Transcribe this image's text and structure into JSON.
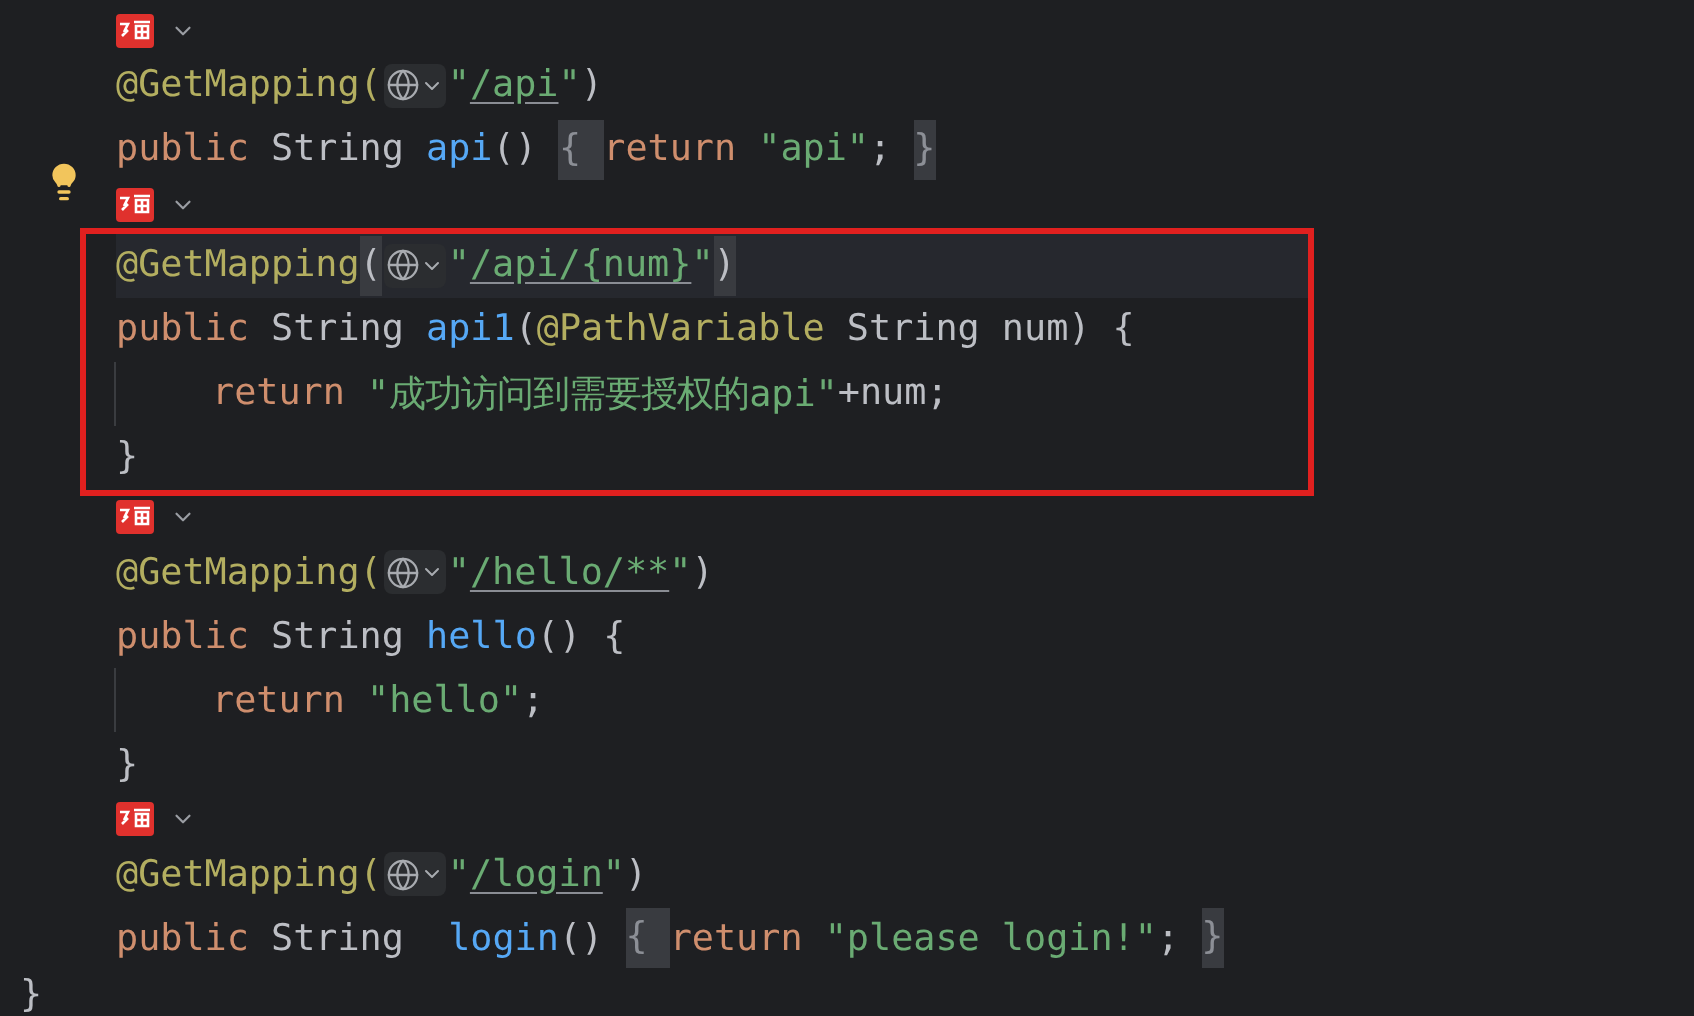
{
  "editor": {
    "methods": [
      {
        "outlined": false,
        "lightbulb": false,
        "lines": [
          {
            "current": false,
            "indented": false,
            "tokens": [
              {
                "kind": "annotation",
                "text": "@GetMapping("
              },
              {
                "kind": "inlay"
              },
              {
                "kind": "string",
                "text": "\""
              },
              {
                "kind": "url",
                "text": "/api"
              },
              {
                "kind": "string",
                "text": "\""
              },
              {
                "kind": "plain",
                "text": ")"
              }
            ]
          },
          {
            "current": false,
            "indented": false,
            "tokens": [
              {
                "kind": "keyword",
                "text": "public "
              },
              {
                "kind": "plain",
                "text": "String "
              },
              {
                "kind": "method",
                "text": "api"
              },
              {
                "kind": "plain",
                "text": "() "
              },
              {
                "kind": "fold",
                "text": "{ "
              },
              {
                "kind": "keyword",
                "text": "return "
              },
              {
                "kind": "string",
                "text": "\"api\""
              },
              {
                "kind": "plain",
                "text": "; "
              },
              {
                "kind": "fold",
                "text": "}"
              }
            ]
          }
        ]
      },
      {
        "outlined": true,
        "lightbulb": true,
        "lines": [
          {
            "current": true,
            "indented": false,
            "tokens": [
              {
                "kind": "annotation",
                "text": "@GetMapping"
              },
              {
                "kind": "match",
                "text": "("
              },
              {
                "kind": "inlay"
              },
              {
                "kind": "string",
                "text": "\""
              },
              {
                "kind": "url",
                "text": "/api/{num}"
              },
              {
                "kind": "string",
                "text": "\""
              },
              {
                "kind": "match",
                "text": ")"
              }
            ]
          },
          {
            "current": false,
            "indented": false,
            "tokens": [
              {
                "kind": "keyword",
                "text": "public "
              },
              {
                "kind": "plain",
                "text": "String "
              },
              {
                "kind": "method",
                "text": "api1"
              },
              {
                "kind": "plain",
                "text": "("
              },
              {
                "kind": "annotation",
                "text": "@PathVariable "
              },
              {
                "kind": "plain",
                "text": "String num) {"
              }
            ]
          },
          {
            "current": false,
            "indented": true,
            "tokens": [
              {
                "kind": "keyword",
                "text": "return "
              },
              {
                "kind": "string",
                "text": "\"成功访问到需要授权的api\""
              },
              {
                "kind": "plain",
                "text": "+num;"
              }
            ]
          },
          {
            "current": false,
            "indented": false,
            "tokens": [
              {
                "kind": "plain",
                "text": "}"
              }
            ]
          }
        ]
      },
      {
        "outlined": false,
        "lightbulb": false,
        "lines": [
          {
            "current": false,
            "indented": false,
            "tokens": [
              {
                "kind": "annotation",
                "text": "@GetMapping("
              },
              {
                "kind": "inlay"
              },
              {
                "kind": "string",
                "text": "\""
              },
              {
                "kind": "url",
                "text": "/hello/**"
              },
              {
                "kind": "string",
                "text": "\""
              },
              {
                "kind": "plain",
                "text": ")"
              }
            ]
          },
          {
            "current": false,
            "indented": false,
            "tokens": [
              {
                "kind": "keyword",
                "text": "public "
              },
              {
                "kind": "plain",
                "text": "String "
              },
              {
                "kind": "method",
                "text": "hello"
              },
              {
                "kind": "plain",
                "text": "() {"
              }
            ]
          },
          {
            "current": false,
            "indented": true,
            "tokens": [
              {
                "kind": "keyword",
                "text": "return "
              },
              {
                "kind": "string",
                "text": "\"hello\""
              },
              {
                "kind": "plain",
                "text": ";"
              }
            ]
          },
          {
            "current": false,
            "indented": false,
            "tokens": [
              {
                "kind": "plain",
                "text": "}"
              }
            ]
          }
        ]
      },
      {
        "outlined": false,
        "lightbulb": false,
        "lines": [
          {
            "current": false,
            "indented": false,
            "tokens": [
              {
                "kind": "annotation",
                "text": "@GetMapping("
              },
              {
                "kind": "inlay"
              },
              {
                "kind": "string",
                "text": "\""
              },
              {
                "kind": "url",
                "text": "/login"
              },
              {
                "kind": "string",
                "text": "\""
              },
              {
                "kind": "plain",
                "text": ")"
              }
            ]
          },
          {
            "current": false,
            "indented": false,
            "tokens": [
              {
                "kind": "keyword",
                "text": "public "
              },
              {
                "kind": "plain",
                "text": "String  "
              },
              {
                "kind": "method",
                "text": "login"
              },
              {
                "kind": "plain",
                "text": "() "
              },
              {
                "kind": "fold",
                "text": "{ "
              },
              {
                "kind": "keyword",
                "text": "return "
              },
              {
                "kind": "string",
                "text": "\"please login!\""
              },
              {
                "kind": "plain",
                "text": "; "
              },
              {
                "kind": "fold",
                "text": "}"
              }
            ]
          }
        ]
      }
    ],
    "closing_line": {
      "tokens": [
        {
          "kind": "plain",
          "text": "}"
        }
      ]
    }
  }
}
